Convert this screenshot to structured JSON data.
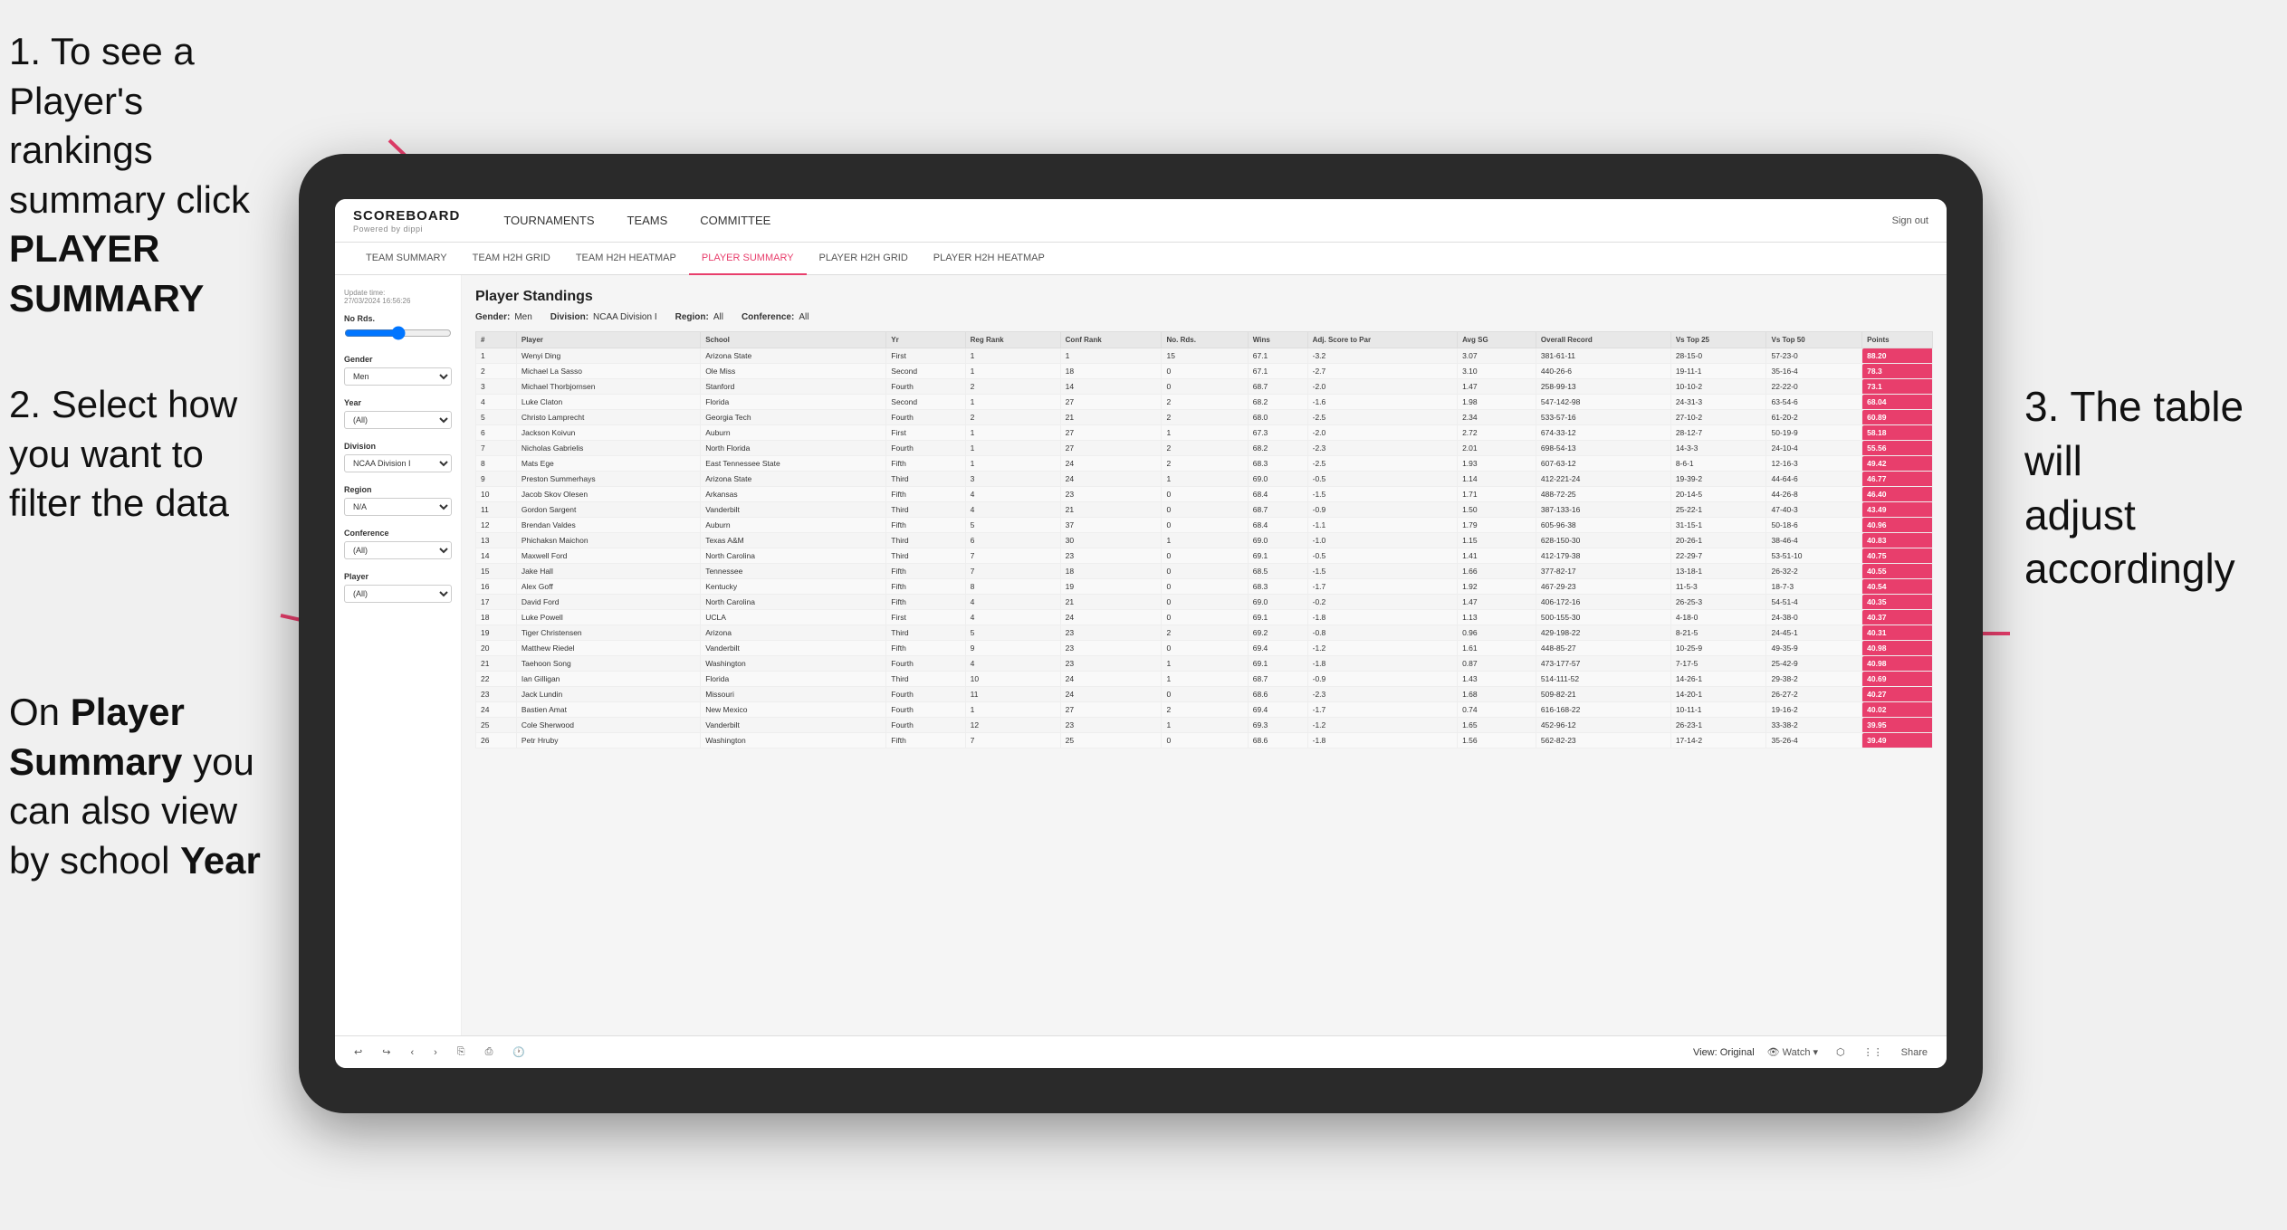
{
  "annotations": {
    "step1": "1. To see a Player's rankings summary click ",
    "step1_bold": "PLAYER SUMMARY",
    "step2_line1": "2. Select how",
    "step2_line2": "you want to",
    "step2_line3": "filter the data",
    "step3_line1": "On ",
    "step3_bold1": "Player",
    "step3_line2": "Summary",
    "step3_line3": " you",
    "step3_line4": "can also view",
    "step3_line5": "by school ",
    "step3_bold2": "Year",
    "annotation_right_line1": "3. The table will",
    "annotation_right_line2": "adjust accordingly"
  },
  "header": {
    "logo": "SCOREBOARD",
    "logo_sub": "Powered by dippi",
    "sign_out": "Sign out",
    "nav_items": [
      "TOURNAMENTS",
      "TEAMS",
      "COMMITTEE"
    ],
    "sub_nav": [
      "TEAM SUMMARY",
      "TEAM H2H GRID",
      "TEAM H2H HEATMAP",
      "PLAYER SUMMARY",
      "PLAYER H2H GRID",
      "PLAYER H2H HEATMAP"
    ]
  },
  "sidebar": {
    "update_time_label": "Update time:",
    "update_time": "27/03/2024 16:56:26",
    "no_rds_label": "No Rds.",
    "gender_label": "Gender",
    "gender_value": "Men",
    "year_label": "Year",
    "year_value": "(All)",
    "division_label": "Division",
    "division_value": "NCAA Division I",
    "region_label": "Region",
    "region_value": "N/A",
    "conference_label": "Conference",
    "conference_value": "(All)",
    "player_label": "Player",
    "player_value": "(All)"
  },
  "table": {
    "title": "Player Standings",
    "filters": {
      "gender_label": "Gender:",
      "gender_value": "Men",
      "division_label": "Division:",
      "division_value": "NCAA Division I",
      "region_label": "Region:",
      "region_value": "All",
      "conference_label": "Conference:",
      "conference_value": "All"
    },
    "columns": [
      "#",
      "Player",
      "School",
      "Yr",
      "Reg Rank",
      "Conf Rank",
      "No. Rds.",
      "Wins",
      "Adj. Score to Par",
      "Avg SG",
      "Overall Record",
      "Vs Top 25",
      "Vs Top 50",
      "Points"
    ],
    "rows": [
      [
        "1",
        "Wenyi Ding",
        "Arizona State",
        "First",
        "1",
        "1",
        "15",
        "67.1",
        "-3.2",
        "3.07",
        "381-61-11",
        "28-15-0",
        "57-23-0",
        "88.20"
      ],
      [
        "2",
        "Michael La Sasso",
        "Ole Miss",
        "Second",
        "1",
        "18",
        "0",
        "67.1",
        "-2.7",
        "3.10",
        "440-26-6",
        "19-11-1",
        "35-16-4",
        "78.3"
      ],
      [
        "3",
        "Michael Thorbjornsen",
        "Stanford",
        "Fourth",
        "2",
        "14",
        "0",
        "68.7",
        "-2.0",
        "1.47",
        "258-99-13",
        "10-10-2",
        "22-22-0",
        "73.1"
      ],
      [
        "4",
        "Luke Claton",
        "Florida",
        "Second",
        "1",
        "27",
        "2",
        "68.2",
        "-1.6",
        "1.98",
        "547-142-98",
        "24-31-3",
        "63-54-6",
        "68.04"
      ],
      [
        "5",
        "Christo Lamprecht",
        "Georgia Tech",
        "Fourth",
        "2",
        "21",
        "2",
        "68.0",
        "-2.5",
        "2.34",
        "533-57-16",
        "27-10-2",
        "61-20-2",
        "60.89"
      ],
      [
        "6",
        "Jackson Koivun",
        "Auburn",
        "First",
        "1",
        "27",
        "1",
        "67.3",
        "-2.0",
        "2.72",
        "674-33-12",
        "28-12-7",
        "50-19-9",
        "58.18"
      ],
      [
        "7",
        "Nicholas Gabrielis",
        "North Florida",
        "Fourth",
        "1",
        "27",
        "2",
        "68.2",
        "-2.3",
        "2.01",
        "698-54-13",
        "14-3-3",
        "24-10-4",
        "55.56"
      ],
      [
        "8",
        "Mats Ege",
        "East Tennessee State",
        "Fifth",
        "1",
        "24",
        "2",
        "68.3",
        "-2.5",
        "1.93",
        "607-63-12",
        "8-6-1",
        "12-16-3",
        "49.42"
      ],
      [
        "9",
        "Preston Summerhays",
        "Arizona State",
        "Third",
        "3",
        "24",
        "1",
        "69.0",
        "-0.5",
        "1.14",
        "412-221-24",
        "19-39-2",
        "44-64-6",
        "46.77"
      ],
      [
        "10",
        "Jacob Skov Olesen",
        "Arkansas",
        "Fifth",
        "4",
        "23",
        "0",
        "68.4",
        "-1.5",
        "1.71",
        "488-72-25",
        "20-14-5",
        "44-26-8",
        "46.40"
      ],
      [
        "11",
        "Gordon Sargent",
        "Vanderbilt",
        "Third",
        "4",
        "21",
        "0",
        "68.7",
        "-0.9",
        "1.50",
        "387-133-16",
        "25-22-1",
        "47-40-3",
        "43.49"
      ],
      [
        "12",
        "Brendan Valdes",
        "Auburn",
        "Fifth",
        "5",
        "37",
        "0",
        "68.4",
        "-1.1",
        "1.79",
        "605-96-38",
        "31-15-1",
        "50-18-6",
        "40.96"
      ],
      [
        "13",
        "Phichaksn Maichon",
        "Texas A&M",
        "Third",
        "6",
        "30",
        "1",
        "69.0",
        "-1.0",
        "1.15",
        "628-150-30",
        "20-26-1",
        "38-46-4",
        "40.83"
      ],
      [
        "14",
        "Maxwell Ford",
        "North Carolina",
        "Third",
        "7",
        "23",
        "0",
        "69.1",
        "-0.5",
        "1.41",
        "412-179-38",
        "22-29-7",
        "53-51-10",
        "40.75"
      ],
      [
        "15",
        "Jake Hall",
        "Tennessee",
        "Fifth",
        "7",
        "18",
        "0",
        "68.5",
        "-1.5",
        "1.66",
        "377-82-17",
        "13-18-1",
        "26-32-2",
        "40.55"
      ],
      [
        "16",
        "Alex Goff",
        "Kentucky",
        "Fifth",
        "8",
        "19",
        "0",
        "68.3",
        "-1.7",
        "1.92",
        "467-29-23",
        "11-5-3",
        "18-7-3",
        "40.54"
      ],
      [
        "17",
        "David Ford",
        "North Carolina",
        "Fifth",
        "4",
        "21",
        "0",
        "69.0",
        "-0.2",
        "1.47",
        "406-172-16",
        "26-25-3",
        "54-51-4",
        "40.35"
      ],
      [
        "18",
        "Luke Powell",
        "UCLA",
        "First",
        "4",
        "24",
        "0",
        "69.1",
        "-1.8",
        "1.13",
        "500-155-30",
        "4-18-0",
        "24-38-0",
        "40.37"
      ],
      [
        "19",
        "Tiger Christensen",
        "Arizona",
        "Third",
        "5",
        "23",
        "2",
        "69.2",
        "-0.8",
        "0.96",
        "429-198-22",
        "8-21-5",
        "24-45-1",
        "40.31"
      ],
      [
        "20",
        "Matthew Riedel",
        "Vanderbilt",
        "Fifth",
        "9",
        "23",
        "0",
        "69.4",
        "-1.2",
        "1.61",
        "448-85-27",
        "10-25-9",
        "49-35-9",
        "40.98"
      ],
      [
        "21",
        "Taehoon Song",
        "Washington",
        "Fourth",
        "4",
        "23",
        "1",
        "69.1",
        "-1.8",
        "0.87",
        "473-177-57",
        "7-17-5",
        "25-42-9",
        "40.98"
      ],
      [
        "22",
        "Ian Gilligan",
        "Florida",
        "Third",
        "10",
        "24",
        "1",
        "68.7",
        "-0.9",
        "1.43",
        "514-111-52",
        "14-26-1",
        "29-38-2",
        "40.69"
      ],
      [
        "23",
        "Jack Lundin",
        "Missouri",
        "Fourth",
        "11",
        "24",
        "0",
        "68.6",
        "-2.3",
        "1.68",
        "509-82-21",
        "14-20-1",
        "26-27-2",
        "40.27"
      ],
      [
        "24",
        "Bastien Amat",
        "New Mexico",
        "Fourth",
        "1",
        "27",
        "2",
        "69.4",
        "-1.7",
        "0.74",
        "616-168-22",
        "10-11-1",
        "19-16-2",
        "40.02"
      ],
      [
        "25",
        "Cole Sherwood",
        "Vanderbilt",
        "Fourth",
        "12",
        "23",
        "1",
        "69.3",
        "-1.2",
        "1.65",
        "452-96-12",
        "26-23-1",
        "33-38-2",
        "39.95"
      ],
      [
        "26",
        "Petr Hruby",
        "Washington",
        "Fifth",
        "7",
        "25",
        "0",
        "68.6",
        "-1.8",
        "1.56",
        "562-82-23",
        "17-14-2",
        "35-26-4",
        "39.49"
      ]
    ]
  },
  "toolbar": {
    "view_label": "View: Original",
    "watch_label": "Watch",
    "share_label": "Share"
  }
}
